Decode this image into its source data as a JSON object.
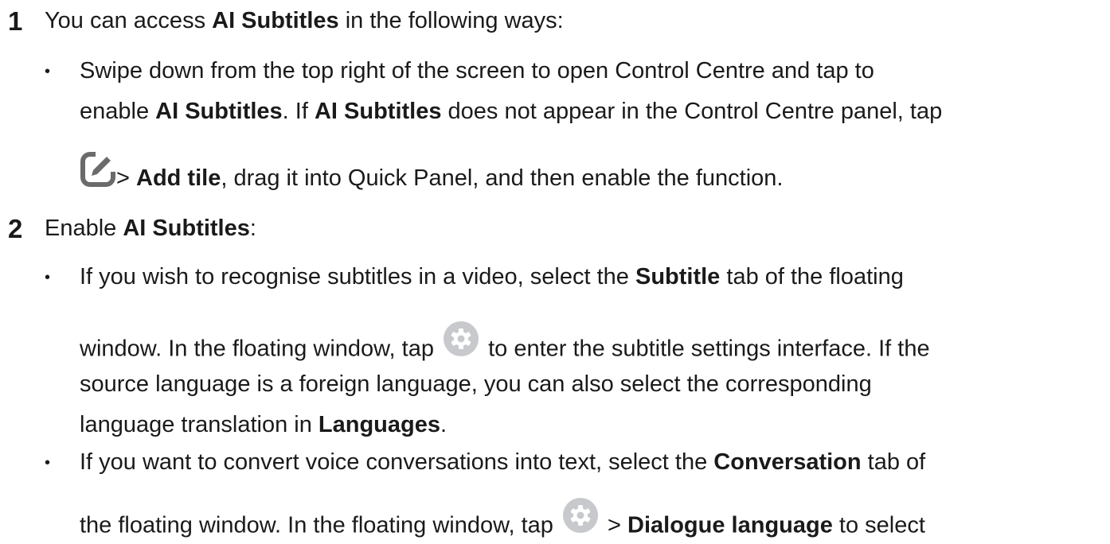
{
  "step1": {
    "number": "1",
    "intro_prefix": "You can access ",
    "intro_bold": "AI Subtitles",
    "intro_suffix": " in the following ways:",
    "bullet": {
      "l1": "Swipe down from the top right of the screen to open Control Centre and tap to",
      "l2_a": "enable ",
      "l2_b": "AI Subtitles",
      "l2_c": ". If ",
      "l2_d": "AI Subtitles",
      "l2_e": " does not appear in the Control Centre panel, tap",
      "l3_a": " > ",
      "l3_b": "Add tile",
      "l3_c": ", drag it into Quick Panel, and then enable the function."
    }
  },
  "step2": {
    "number": "2",
    "intro_prefix": "Enable ",
    "intro_bold": "AI Subtitles",
    "intro_suffix": ":",
    "bullet1": {
      "l1_a": "If you wish to recognise subtitles in a video, select the ",
      "l1_b": "Subtitle",
      "l1_c": " tab of the floating",
      "l2_a": "window. In the floating window, tap ",
      "l2_b": " to enter the subtitle settings interface. If the",
      "l3": "source language is a foreign language, you can also select the corresponding",
      "l4_a": "language translation in ",
      "l4_b": "Languages",
      "l4_c": "."
    },
    "bullet2": {
      "l1_a": "If you want to convert voice conversations into text, select the ",
      "l1_b": "Conversation",
      "l1_c": " tab of",
      "l2_a": "the floating window. In the floating window, tap ",
      "l2_b": " > ",
      "l2_c": "Dialogue language",
      "l2_d": " to select"
    }
  },
  "bullet_char": "•",
  "icons": {
    "edit": "edit-icon",
    "settings": "gear-icon"
  },
  "colors": {
    "text": "#1a1a1a",
    "edit_icon": "#6b6b6b",
    "gear_icon": "#c7c9cc"
  }
}
